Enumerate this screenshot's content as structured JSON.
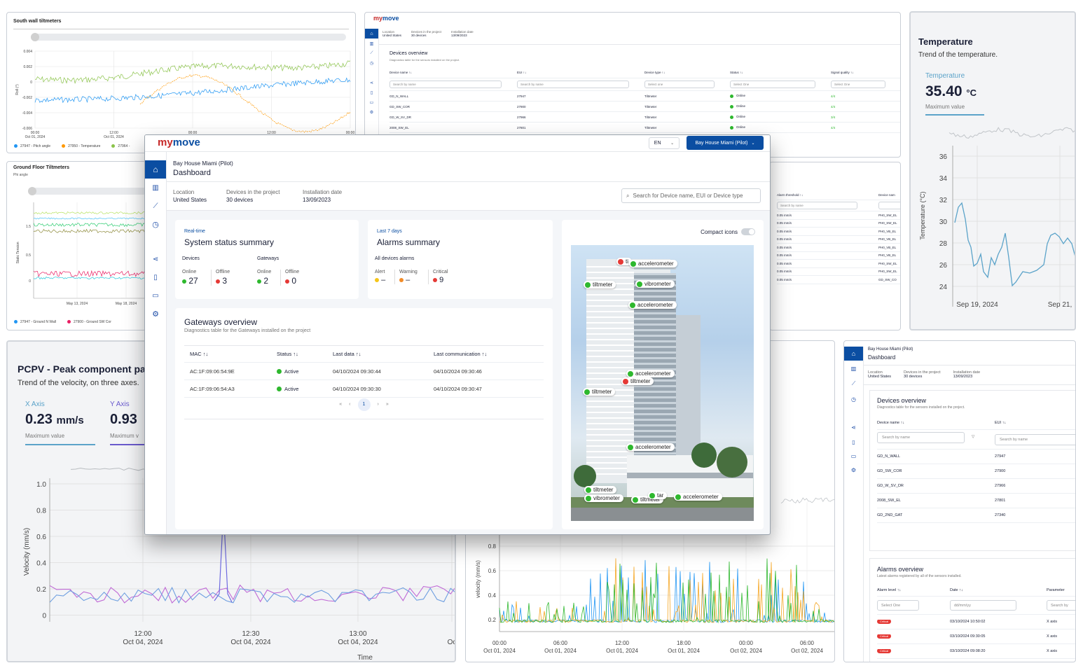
{
  "colors": {
    "brand_blue": "#0b4ea2",
    "brand_red": "#c62828",
    "green": "#2eb82e",
    "red": "#e53935",
    "yellow": "#f5c518",
    "orange": "#f28c28",
    "temp_line": "#5ba3c9"
  },
  "icons": [
    "home-icon",
    "bar-chart-icon",
    "line-chart-icon",
    "clock-icon",
    "share-icon",
    "document-icon",
    "folder-icon",
    "gear-icon",
    "search-icon",
    "chevron-down-icon",
    "filter-icon",
    "sort-icon"
  ],
  "south_wall": {
    "title": "South wall tiltmeters",
    "y_ticks": [
      "0.004",
      "0.002",
      "0",
      "-0.002",
      "-0.004",
      "-0.006"
    ],
    "y_label": "Roll (°)",
    "x_ticks": [
      {
        "time": "00:00",
        "date": "Oct 01, 2024"
      },
      {
        "time": "12:00",
        "date": "Oct 01, 2024"
      },
      {
        "time": "00:00",
        "date": "Oct 02, 2024"
      },
      {
        "time": "12:00",
        "date": "Oct 02, 2024"
      },
      {
        "time": "00:00",
        "date": "Oct 03, 2024"
      }
    ],
    "legend": [
      {
        "label": "27947 - Pitch angle",
        "color": "#2196f3"
      },
      {
        "label": "27950 - Temperature",
        "color": "#ff9800"
      },
      {
        "label": "27964 -",
        "color": "#8bc34a"
      }
    ]
  },
  "devices_panel": {
    "location_label": "Location",
    "location_value": "United States",
    "devices_label": "Devices in the project",
    "devices_value": "30 devices",
    "install_label": "Installation date",
    "install_value": "13/09/2023",
    "title": "Devices overview",
    "subtitle": "Diagnostics table for the sensors installed on the project.",
    "columns": [
      "Device name ↑↓",
      "EUI ↑↓",
      "Device type ↑↓",
      "Status ↑↓",
      "Signal quality ↑↓"
    ],
    "filters": [
      "Search by name",
      "Search by name",
      "Select one",
      "Select One",
      "Select One"
    ],
    "rows": [
      {
        "name": "GD_N_WALL",
        "eui": "27947",
        "type": "Tiltmeter",
        "status": "Online",
        "signal": "4/4"
      },
      {
        "name": "GD_SW_COR",
        "eui": "27900",
        "type": "Tiltmeter",
        "status": "Online",
        "signal": "4/4"
      },
      {
        "name": "GD_W_SV_DR",
        "eui": "27966",
        "type": "Tiltmeter",
        "status": "Online",
        "signal": "3/4"
      },
      {
        "name": "2008_SW_EL",
        "eui": "27801",
        "type": "Tiltmeter",
        "status": "Online",
        "signal": "4/4"
      }
    ]
  },
  "temperature": {
    "title": "Temperature",
    "subtitle": "Trend of the temperature.",
    "kpi_label": "Temperature",
    "kpi_value": "35.40",
    "kpi_unit": "°C",
    "kpi_caption": "Maximum value",
    "y_label": "Temperature (°C)",
    "y_ticks": [
      "36",
      "34",
      "32",
      "30",
      "28",
      "26",
      "24"
    ],
    "x_ticks": [
      "Sep 19, 2024",
      "Sep 21,"
    ]
  },
  "ground_floor": {
    "title": "Ground Floor Tiltmeters",
    "subtitle": "Phi angle",
    "y_ticks": [
      "1.5",
      "0.5",
      "0"
    ],
    "y_label": "Static Tension",
    "x_ticks": [
      "May 13, 2024",
      "May 18, 2024"
    ],
    "legend": [
      {
        "label": "27947 - Ground N Wall",
        "color": "#2196f3"
      },
      {
        "label": "27900 - Ground SW Cor",
        "color": "#e91e63"
      }
    ]
  },
  "alarm_threshold": {
    "columns": [
      "Alarm threshold ↑↓",
      "Device nam"
    ],
    "filter": "Search by name",
    "rows": [
      {
        "threshold": "0.05 mm/s",
        "device": "PH0_SW_EL"
      },
      {
        "threshold": "0.05 mm/s",
        "device": "PH0_SW_EL"
      },
      {
        "threshold": "0.05 mm/s",
        "device": "PH0_VB_EL"
      },
      {
        "threshold": "0.05 mm/s",
        "device": "PH0_VB_EL"
      },
      {
        "threshold": "0.05 mm/s",
        "device": "PH0_VB_EL"
      },
      {
        "threshold": "0.05 mm/s",
        "device": "PH0_VB_EL"
      },
      {
        "threshold": "0.05 mm/s",
        "device": "PH0_SW_EL"
      },
      {
        "threshold": "0.05 mm/s",
        "device": "PH0_SW_EL"
      },
      {
        "threshold": "0.05 mm/s",
        "device": "GD_SW_CO"
      }
    ]
  },
  "pcpv": {
    "title": "PCPV - Peak component par",
    "subtitle": "Trend of the velocity, on three axes.",
    "x_axis_label": "X Axis",
    "x_axis_value": "0.23",
    "x_axis_unit": "mm/s",
    "x_caption": "Maximum value",
    "y_axis_label": "Y Axis",
    "y_axis_value": "0.93",
    "y_caption": "Maximum v",
    "y_label": "Velocity (mm/s)",
    "y_ticks": [
      "1.0",
      "0.8",
      "0.6",
      "0.4",
      "0.2",
      "0"
    ],
    "x_ticks": [
      {
        "time": "12:00",
        "date": "Oct 04, 2024"
      },
      {
        "time": "12:30",
        "date": "Oct 04, 2024"
      },
      {
        "time": "13:00",
        "date": "Oct 04, 2024"
      },
      {
        "time": "",
        "date": "Oc"
      }
    ],
    "x_label": "Time"
  },
  "velocity": {
    "y_label": "velocity (mm/s)",
    "y_ticks": [
      "0.8",
      "0.6",
      "0.4",
      "0.2"
    ],
    "x_ticks": [
      {
        "time": "00:00",
        "date": "Oct 01, 2024"
      },
      {
        "time": "06:00",
        "date": "Oct 01, 2024"
      },
      {
        "time": "12:00",
        "date": "Oct 01, 2024"
      },
      {
        "time": "18:00",
        "date": "Oct 01, 2024"
      },
      {
        "time": "00:00",
        "date": "Oct 02, 2024"
      },
      {
        "time": "06:00",
        "date": "Oct 02, 2024"
      }
    ]
  },
  "right_dashboard": {
    "project": "Bay House Miami (Pilot)",
    "page": "Dashboard",
    "location_label": "Location",
    "location_value": "United States",
    "devices_label": "Devices in the project",
    "devices_value": "30 devices",
    "install_label": "Installation date",
    "install_value": "13/09/2023",
    "devices_title": "Devices overview",
    "devices_subtitle": "Diagnostics table for the sensors installed on the project.",
    "columns": [
      "Device name ↑↓",
      "EUI ↑↓"
    ],
    "filters": [
      "Search by name",
      "Search by name"
    ],
    "rows": [
      {
        "name": "GD_N_WALL",
        "eui": "27947"
      },
      {
        "name": "GD_SW_COR",
        "eui": "27900"
      },
      {
        "name": "GD_W_SV_DR",
        "eui": "27966"
      },
      {
        "name": "2008_SW_EL",
        "eui": "27801"
      },
      {
        "name": "GD_2ND_GAT",
        "eui": "27340"
      }
    ],
    "alarms_title": "Alarms overview",
    "alarms_subtitle": "Latest alarms registered by all of the sensors installed.",
    "alarm_columns": [
      "Alarm level ↑↓",
      "Date ↑↓",
      "Parameter"
    ],
    "alarm_filters": [
      "Select One",
      "dd/mm/yy",
      "Search by"
    ],
    "alarm_rows": [
      {
        "level": "Critical",
        "date": "03/10/2024 10:50:02",
        "param": "X axis"
      },
      {
        "level": "Critical",
        "date": "03/10/2024 09:30:05",
        "param": "X axis"
      },
      {
        "level": "Critical",
        "date": "03/10/2024 09:08:20",
        "param": "X axis"
      }
    ]
  },
  "main": {
    "logo_my": "my",
    "logo_move": "move",
    "language": "EN",
    "project_button": "Bay House Miami (Pilot)",
    "project": "Bay House Miami (Pilot)",
    "page": "Dashboard",
    "location_label": "Location",
    "location_value": "United States",
    "devices_label": "Devices in the project",
    "devices_value": "30 devices",
    "install_label": "Installation date",
    "install_value": "13/09/2023",
    "search_placeholder": "Search for Device name, EUI or Device type",
    "status_card": {
      "eyebrow": "Real-time",
      "title": "System status summary",
      "devices_label": "Devices",
      "gateways_label": "Gateways",
      "online_label": "Online",
      "offline_label": "Offline",
      "devices_online": "27",
      "devices_offline": "3",
      "gateways_online": "2",
      "gateways_offline": "0"
    },
    "alarms_card": {
      "eyebrow": "Last 7 days",
      "title": "Alarms summary",
      "all_label": "All devices alarms",
      "alert_label": "Alert",
      "warning_label": "Warning",
      "critical_label": "Critical",
      "alert_value": "–",
      "warning_value": "–",
      "critical_value": "9"
    },
    "gateways": {
      "title": "Gateways overview",
      "subtitle": "Diagnostics table for the Gateways installed on the project",
      "columns": [
        "MAC ↑↓",
        "Status ↑↓",
        "Last data ↑↓",
        "Last communication ↑↓"
      ],
      "rows": [
        {
          "mac": "AC:1F:09:06:54:9E",
          "status": "Active",
          "last_data": "04/10/2024 09:30:44",
          "last_comm": "04/10/2024 09:30:46"
        },
        {
          "mac": "AC:1F:09:06:54:A3",
          "status": "Active",
          "last_data": "04/10/2024 09:30:30",
          "last_comm": "04/10/2024 09:30:47"
        }
      ],
      "pagination": [
        "«",
        "‹",
        "1",
        "›",
        "»"
      ]
    },
    "compact_icons_label": "Compact icons",
    "markers": [
      {
        "label": "ti",
        "color": "#e53935"
      },
      {
        "label": "accelerometer",
        "color": "#2eb82e"
      },
      {
        "label": "tiltmeter",
        "color": "#2eb82e"
      },
      {
        "label": "vibrometer",
        "color": "#2eb82e"
      },
      {
        "label": "accelerometer",
        "color": "#2eb82e"
      },
      {
        "label": "accelerometer",
        "color": "#2eb82e"
      },
      {
        "label": "tiltmeter",
        "color": "#e53935"
      },
      {
        "label": "tiltmeter",
        "color": "#2eb82e"
      },
      {
        "label": "accelerometer",
        "color": "#2eb82e"
      },
      {
        "label": "tiltmeter",
        "color": "#2eb82e"
      },
      {
        "label": "vibrometer",
        "color": "#2eb82e"
      },
      {
        "label": "tiltmeter",
        "color": "#2eb82e"
      },
      {
        "label": "tar",
        "color": "#2eb82e"
      },
      {
        "label": "accelerometer",
        "color": "#2eb82e"
      }
    ]
  }
}
